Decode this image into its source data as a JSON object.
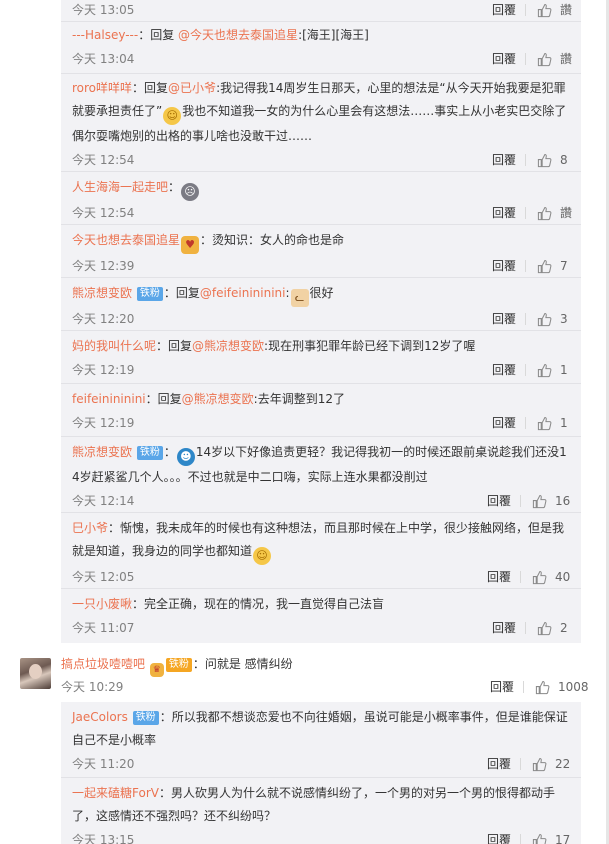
{
  "labels": {
    "reply": "回覆",
    "like_word": "讚"
  },
  "colors": {
    "username": "#eb7350",
    "mention": "#eb7350",
    "badge_blue": "#5aa6e8",
    "meta_gray": "#808080",
    "sub_bg": "#f2f2f5"
  },
  "sub_comments_a": [
    {
      "id": "c0",
      "user": "",
      "parts": [],
      "time": "今天 13:05",
      "likes": "讚"
    },
    {
      "id": "c1",
      "user": "---Halsey---",
      "parts": [
        "：回复 ",
        "@今天也想去泰国追星",
        ":[海王][海王]"
      ],
      "time": "今天 13:04",
      "likes": "讚"
    },
    {
      "id": "c2",
      "user": "roro咩咩咩",
      "parts": [
        "：回复",
        "@已小爷",
        ":我记得我14周岁生日那天，心里的想法是“从今天开始我要是犯罪就要承担责任了”",
        "我也不知道我一女的为什么心里会有这想法……事实上从小老实巴交除了偶尔耍嘴炮别的出格的事儿啥也没敢干过……"
      ],
      "time": "今天 12:54",
      "likes": "8"
    },
    {
      "id": "c3",
      "user": "人生海海一起走吧",
      "parts": [
        "："
      ],
      "time": "今天 12:54",
      "likes": "讚"
    },
    {
      "id": "c4",
      "user": "今天也想去泰国追星",
      "parts": [
        "：烫知识：女人的命也是命"
      ],
      "time": "今天 12:39",
      "likes": "7"
    },
    {
      "id": "c5",
      "user": "熊凉想变欧",
      "badge": "铁粉",
      "parts": [
        "：回复",
        "@feifeinininini",
        ":",
        "很好"
      ],
      "time": "今天 12:20",
      "likes": "3"
    },
    {
      "id": "c6",
      "user": "妈的我叫什么呢",
      "parts": [
        "：回复",
        "@熊凉想变欧",
        ":现在刑事犯罪年龄已经下调到12岁了喔"
      ],
      "time": "今天 12:19",
      "likes": "1"
    },
    {
      "id": "c7",
      "user": "feifeinininini",
      "parts": [
        "：回复",
        "@熊凉想变欧",
        ":去年调整到12了"
      ],
      "time": "今天 12:19",
      "likes": "1"
    },
    {
      "id": "c8",
      "user": "熊凉想变欧",
      "badge": "铁粉",
      "parts": [
        "：",
        "14岁以下好像追责更轻？我记得我初一的时候还跟前桌说趁我们还没14岁赶紧鲨几个人。。。不过也就是中二口嗨，实际上连水果都没削过"
      ],
      "time": "今天 12:14",
      "likes": "16"
    },
    {
      "id": "c9",
      "user": "巳小爷",
      "parts": [
        "：惭愧，我未成年的时候也有这种想法，而且那时候在上中学，很少接触网络，但是我就是知道，我身边的同学也都知道"
      ],
      "time": "今天 12:05",
      "likes": "40"
    },
    {
      "id": "c10",
      "user": "一只小废啾",
      "parts": [
        "：完全正确，现在的情况，我一直觉得自己法盲"
      ],
      "time": "今天 11:07",
      "likes": "2"
    }
  ],
  "top_comment": {
    "user": "搞点垃圾噎噎吧",
    "badge": "铁粉",
    "text": "：问就是 感情纠纷",
    "time": "今天 10:29",
    "likes": "1008"
  },
  "sub_comments_b": [
    {
      "id": "d1",
      "user": "JaeColors",
      "badge": "铁粉",
      "parts": [
        "：所以我都不想谈恋爱也不向往婚姻，虽说可能是小概率事件，但是谁能保证自己不是小概率"
      ],
      "time": "今天 11:20",
      "likes": "22"
    },
    {
      "id": "d2",
      "user": "一起来磕糖ForV",
      "parts": [
        "：男人砍男人为什么就不说感情纠纷了，一个男的对另一个男的恨得都动手了，这感情还不强烈吗？还不纠纷吗？"
      ],
      "time": "今天 13:15",
      "likes": "17"
    }
  ]
}
